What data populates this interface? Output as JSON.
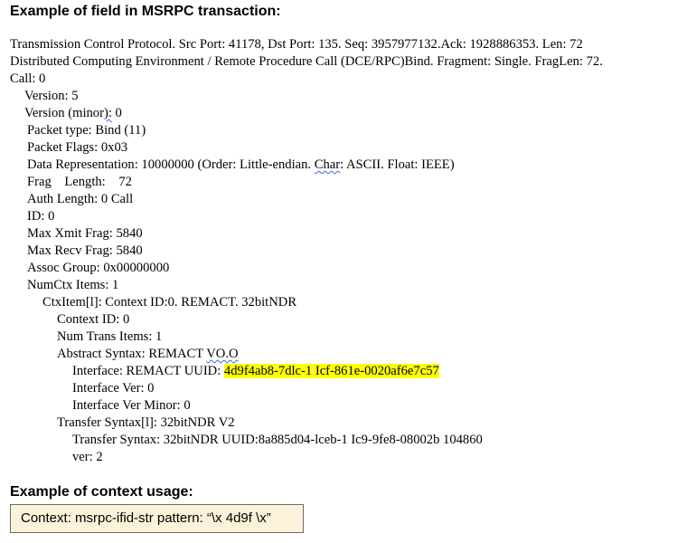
{
  "heading_transaction": "Example of field in MSRPC transaction:",
  "lines": {
    "tcp": "Transmission Control Protocol. Src Port: 41178, Dst Port: 135. Seq: 3957977132.Ack: 1928886353. Len: 72",
    "dcerpc": "Distributed Computing Environment / Remote Procedure Call (DCE/RPC)Bind. Fragment: Single. FragLen: 72.",
    "call": "Call: 0",
    "version": "Version: 5",
    "version_minor_prefix": "Version (minor",
    "version_minor_squiggle": "):",
    "version_minor_suffix": " 0",
    "packet_type": "Packet type: Bind (11)",
    "packet_flags": "Packet Flags: 0x03",
    "data_rep_prefix": "Data Representation: 10000000 (Order: Little-endian. ",
    "data_rep_squiggle": "Char",
    "data_rep_suffix": ": ASCII. Float: IEEE)",
    "frag_length": "Frag    Length:    72",
    "auth_length": "Auth Length: 0 Call",
    "id": "ID: 0",
    "max_xmit": "Max Xmit Frag: 5840",
    "max_recv": "Max Recv Frag: 5840",
    "assoc_group": "Assoc Group: 0x00000000",
    "num_ctx": "NumCtx Items: 1",
    "ctx_item": "CtxItem[l]: Context ID:0. REMACT. 32bitNDR",
    "context_id": "Context ID: 0",
    "num_trans": "Num Trans Items: 1",
    "abstract_prefix": "Abstract Syntax: REMACT ",
    "abstract_squiggle": "VO.O",
    "interface_prefix": "Interface: REMACT UUID: ",
    "interface_uuid": "4d9f4ab8-7dlc-1 Icf-861e-0020af6e7c57",
    "interface_ver": "Interface Ver: 0",
    "interface_ver_minor": "Interface Ver Minor: 0",
    "transfer_syntax_item": "Transfer Syntax[l]: 32bitNDR V2",
    "transfer_syntax": "Transfer Syntax: 32bitNDR UUID:8a885d04-lceb-1 Ic9-9fe8-08002b 104860",
    "ver": "ver: 2"
  },
  "heading_context": "Example of context usage:",
  "context_box": "Context: msrpc-ifid-str pattern: “\\x 4d9f \\x”",
  "colors": {
    "highlight": "#ffff00",
    "context_box_bg": "#fcf2d9",
    "squiggle": "#3a6fd8"
  }
}
